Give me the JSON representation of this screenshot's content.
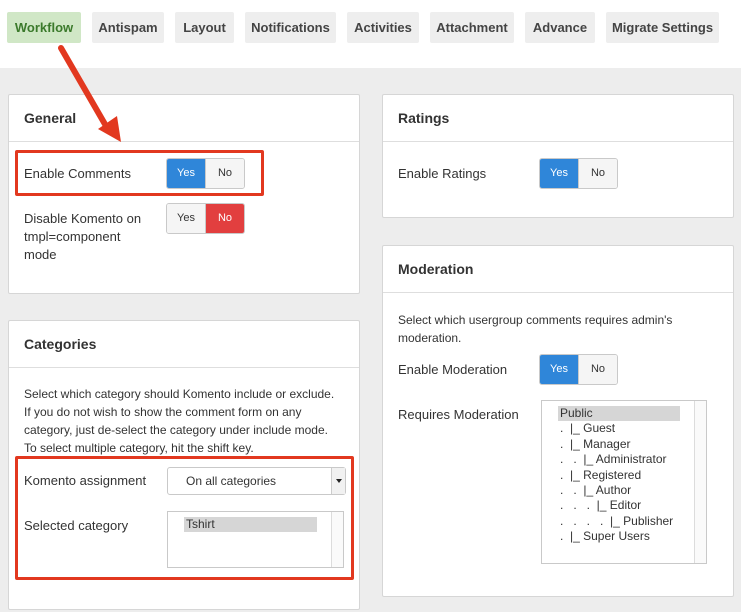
{
  "tabs": {
    "workflow": "Workflow",
    "antispam": "Antispam",
    "layout": "Layout",
    "notifications": "Notifications",
    "activities": "Activities",
    "attachment": "Attachment",
    "advance": "Advance",
    "migrate": "Migrate Settings"
  },
  "general": {
    "title": "General",
    "enable_comments": {
      "label": "Enable Comments",
      "yes": "Yes",
      "no": "No",
      "value": "Yes"
    },
    "disable_komento": {
      "label_line1": "Disable Komento on",
      "label_line2": "tmpl=component",
      "label_line3": "mode",
      "yes": "Yes",
      "no": "No",
      "value": "No"
    }
  },
  "categories": {
    "title": "Categories",
    "desc_line1": "Select which category should Komento include or exclude.",
    "desc_line2": "If you do not wish to show the comment form on any",
    "desc_line3": "category, just de-select the category under include mode.",
    "desc_line4": "To select multiple category, hit the shift key.",
    "assignment_label": "Komento assignment",
    "assignment_value": "On all categories",
    "selected_label": "Selected category",
    "selected_options": [
      "Tshirt"
    ]
  },
  "ratings": {
    "title": "Ratings",
    "enable_ratings": {
      "label": "Enable Ratings",
      "yes": "Yes",
      "no": "No",
      "value": "Yes"
    }
  },
  "moderation": {
    "title": "Moderation",
    "desc_line1": "Select which usergroup comments requires admin's",
    "desc_line2": "moderation.",
    "enable_moderation": {
      "label": "Enable Moderation",
      "yes": "Yes",
      "no": "No",
      "value": "Yes"
    },
    "requires_label": "Requires Moderation",
    "groups": [
      "Public",
      ".  |_ Guest",
      ".  |_ Manager",
      ".   .  |_ Administrator",
      ".  |_ Registered",
      ".   .  |_ Author",
      ".   .   .  |_ Editor",
      ".   .   .   .  |_ Publisher",
      ".  |_ Super Users"
    ]
  },
  "colors": {
    "active_tab_bg": "#d0e7c6",
    "active_tab_text": "#3b7a2b",
    "toggle_yes": "#2f86d9",
    "toggle_no_active": "#e23f3f",
    "highlight": "#e2381f"
  },
  "icons": {
    "annotation_arrow": "arrow-icon",
    "select_caret": "chevron-down-icon"
  }
}
